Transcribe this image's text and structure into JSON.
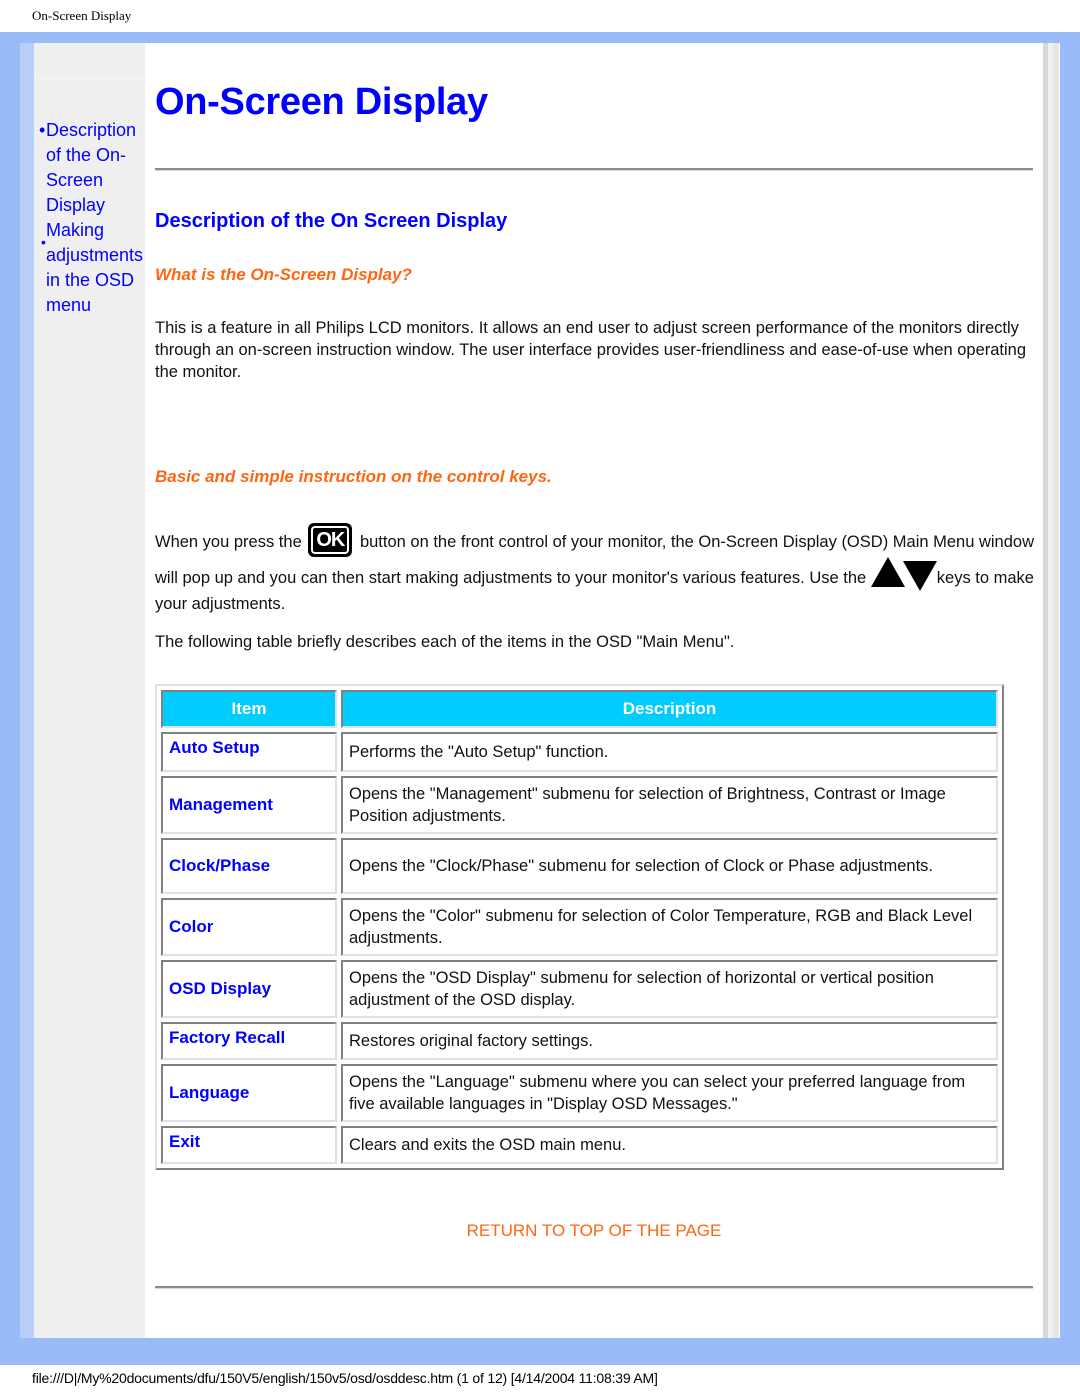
{
  "print_header": "On-Screen Display",
  "sidebar": {
    "items": [
      {
        "bullet": "•",
        "label": "Description of the On-Screen Display"
      },
      {
        "bullet": "•",
        "label": "Making adjustments in the OSD menu"
      }
    ]
  },
  "main": {
    "title": "On-Screen Display",
    "section_title": "Description of the On Screen Display",
    "subhead_what": "What is the On-Screen Display?",
    "intro": "This is a feature in all Philips LCD monitors. It allows an end user to adjust screen performance of the monitors directly through an on-screen instruction window. The user interface provides user-friendliness and ease-of-use when operating the monitor.",
    "subhead_basic": "Basic and simple instruction on the control keys.",
    "instruction": {
      "part1": "When you press the",
      "ok_icon": "OK",
      "part2": "button on the front control of your monitor, the On-Screen Display (OSD) Main Menu window will pop up and you can then start making adjustments to your monitor's various features. Use the",
      "part3": "keys to make your adjustments."
    },
    "table_intro": "The following table briefly describes each of the items in the OSD \"Main Menu\".",
    "table": {
      "headers": [
        "Item",
        "Description"
      ],
      "header_color": "#00ccff",
      "rows": [
        {
          "item": "Auto Setup",
          "description": "Performs the \"Auto Setup\" function."
        },
        {
          "item": "Management",
          "description": "Opens the \"Management\" submenu for selection of Brightness, Contrast or Image Position adjustments."
        },
        {
          "item": "Clock/Phase",
          "description": "Opens the \"Clock/Phase\" submenu for selection of Clock or Phase adjustments."
        },
        {
          "item": "Color",
          "description": "Opens the \"Color\" submenu for selection of Color Temperature, RGB and Black Level adjustments."
        },
        {
          "item": "OSD Display",
          "description": "Opens the \"OSD Display\" submenu for selection of horizontal or vertical position adjustment of the OSD display."
        },
        {
          "item": "Factory Recall",
          "description": "Restores original factory settings."
        },
        {
          "item": "Language",
          "description": "Opens the \"Language\" submenu where you can select your preferred language from five available languages in \"Display OSD Messages.\""
        },
        {
          "item": "Exit",
          "description": "Clears and exits the OSD main menu."
        }
      ]
    },
    "return_link": "RETURN TO TOP OF THE PAGE"
  },
  "colors": {
    "link_blue": "#0000ff",
    "accent_orange": "#ff6611",
    "frame_blue": "#99bbf7"
  },
  "print_footer": "file:///D|/My%20documents/dfu/150V5/english/150v5/osd/osddesc.htm (1 of 12) [4/14/2004 11:08:39 AM]"
}
